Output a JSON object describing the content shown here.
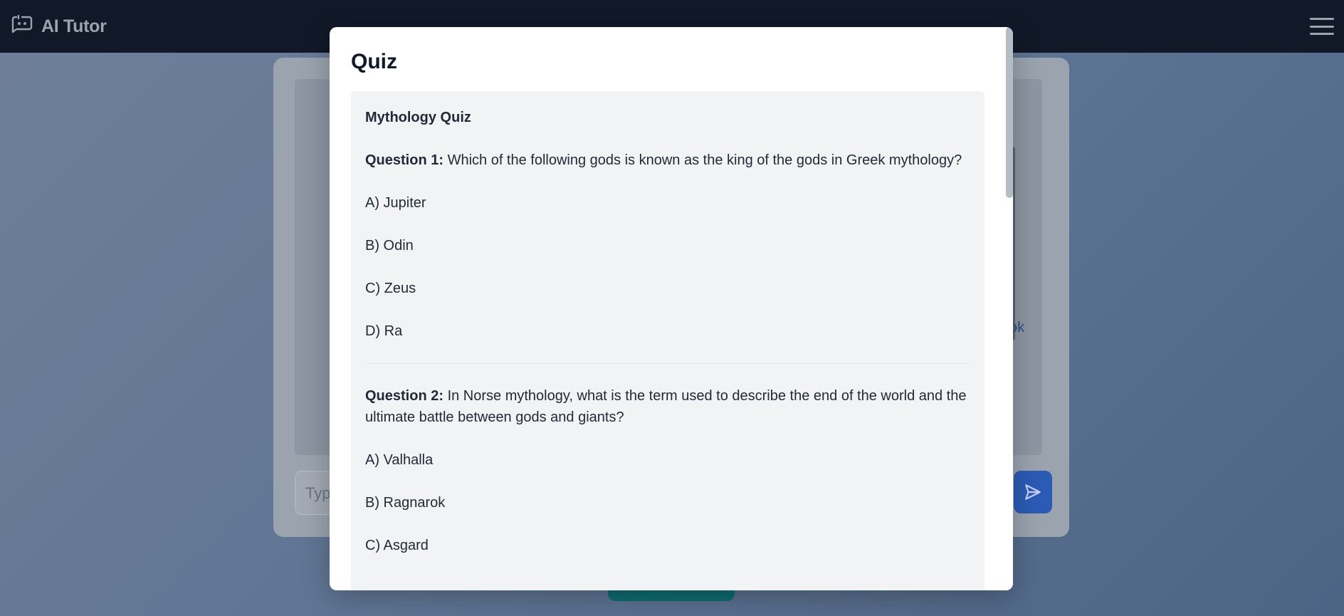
{
  "app": {
    "title": "AI Tutor"
  },
  "chat": {
    "input_placeholder": "Typ",
    "link_fragment": "ok"
  },
  "modal": {
    "title": "Quiz",
    "quiz_title": "Mythology Quiz",
    "questions": [
      {
        "label": "Question 1:",
        "text": " Which of the following gods is known as the king of the gods in Greek mythology?",
        "options": [
          "A) Jupiter",
          "B) Odin",
          "C) Zeus",
          "D) Ra"
        ]
      },
      {
        "label": "Question 2:",
        "text": " In Norse mythology, what is the term used to describe the end of the world and the ultimate battle between gods and giants?",
        "options": [
          "A) Valhalla",
          "B) Ragnarok",
          "C) Asgard"
        ]
      }
    ]
  },
  "colors": {
    "nav_bg": "#111827",
    "accent": "#2c5bb5",
    "modal_bg": "#ffffff",
    "quiz_bg": "#f2f3f5"
  },
  "icons": {
    "brand": "chat-bot-icon",
    "menu": "hamburger-menu-icon",
    "send": "send-icon"
  }
}
